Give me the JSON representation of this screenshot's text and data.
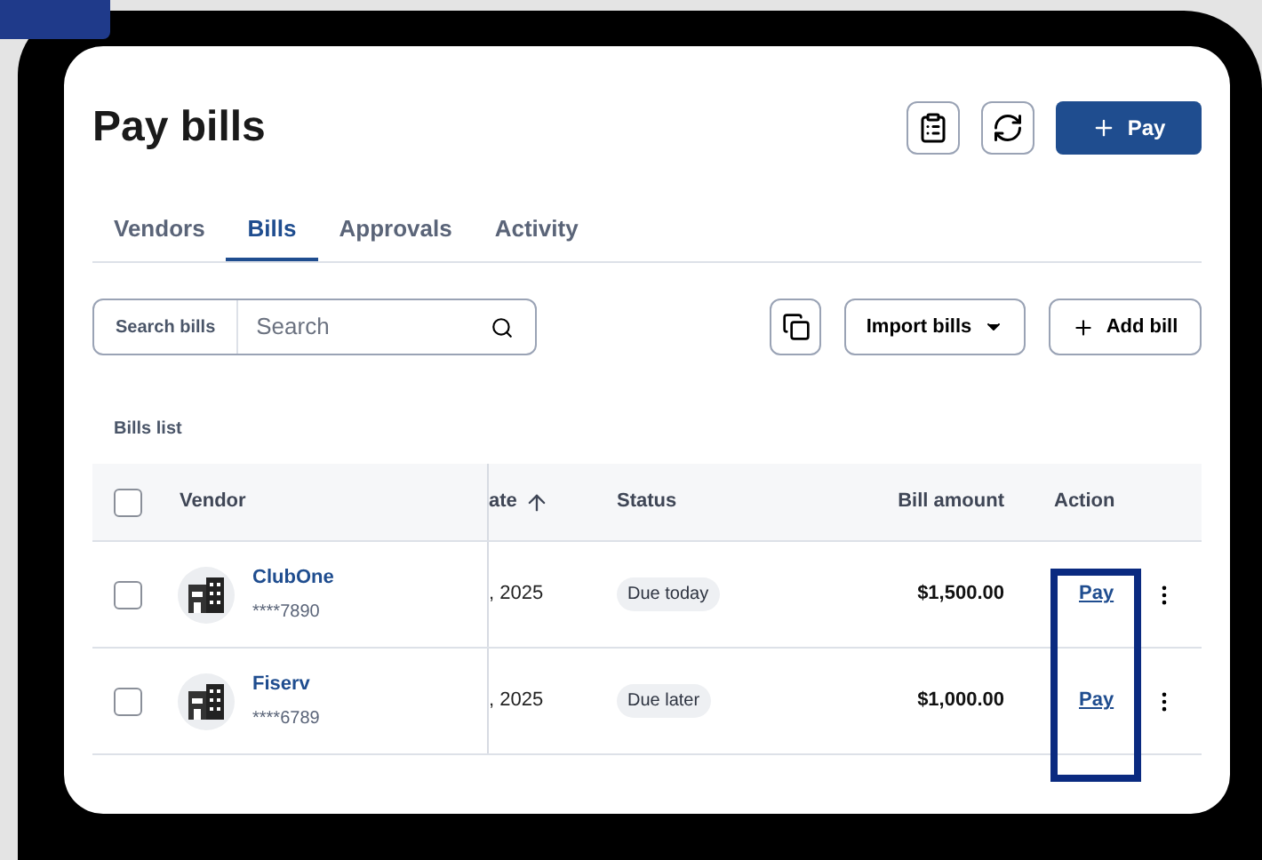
{
  "page": {
    "title": "Pay bills",
    "pay_button": "Pay"
  },
  "tabs": [
    {
      "label": "Vendors",
      "selected": false
    },
    {
      "label": "Bills",
      "selected": true
    },
    {
      "label": "Approvals",
      "selected": false
    },
    {
      "label": "Activity",
      "selected": false
    }
  ],
  "search": {
    "label": "Search bills",
    "placeholder": "Search"
  },
  "toolbar": {
    "import_button": "Import bills",
    "add_button": "Add bill"
  },
  "table": {
    "title": "Bills list",
    "all_selected": false,
    "columns": [
      "Vendor",
      "ate",
      "Status",
      "Bill amount",
      "Action"
    ],
    "rows": [
      {
        "selected": false,
        "vendor": "ClubOne",
        "account": "****7890",
        "date": ", 2025",
        "status": "Due today",
        "amount": "$1,500.00",
        "action": "Pay"
      },
      {
        "selected": false,
        "vendor": "Fiserv",
        "account": "****6789",
        "date": ", 2025",
        "status": "Due later",
        "amount": "$1,000.00",
        "action": "Pay"
      }
    ]
  }
}
